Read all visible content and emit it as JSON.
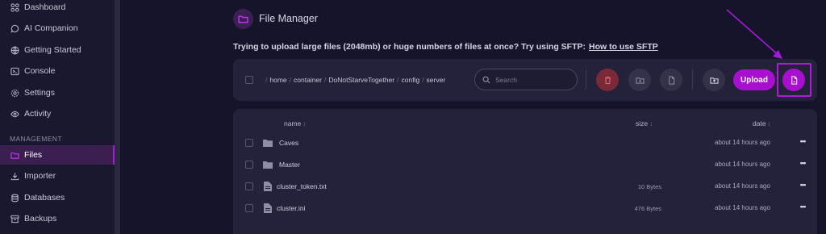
{
  "sidebar": {
    "items": [
      {
        "label": "Dashboard",
        "icon": "dashboard-icon"
      },
      {
        "label": "AI Companion",
        "icon": "chat-icon"
      },
      {
        "label": "Getting Started",
        "icon": "globe-icon"
      },
      {
        "label": "Console",
        "icon": "terminal-icon"
      },
      {
        "label": "Settings",
        "icon": "gear-icon"
      },
      {
        "label": "Activity",
        "icon": "eye-icon"
      }
    ],
    "section_label": "MANAGEMENT",
    "management_items": [
      {
        "label": "Files",
        "icon": "folder-icon",
        "active": true
      },
      {
        "label": "Importer",
        "icon": "download-icon"
      },
      {
        "label": "Databases",
        "icon": "database-icon"
      },
      {
        "label": "Backups",
        "icon": "archive-icon"
      }
    ]
  },
  "header": {
    "title": "File Manager",
    "icon": "folder-icon"
  },
  "notice": {
    "text": "Trying to upload large files (2048mb) or huge numbers of files at once? Try using SFTP:",
    "link": "How to use SFTP"
  },
  "toolbar": {
    "breadcrumb": [
      "home",
      "container",
      "DoNotStarveTogether",
      "config",
      "server"
    ],
    "search_placeholder": "Search",
    "upload_label": "Upload",
    "buttons": [
      "trash-icon",
      "folder-plus-icon",
      "file-icon",
      "folder-upload-icon",
      "file-new-icon"
    ]
  },
  "table": {
    "columns": {
      "name": "name",
      "size": "size",
      "date": "date"
    },
    "sort_arrow": "↓",
    "rows": [
      {
        "type": "folder",
        "name": "Caves",
        "size": "",
        "date": "about 14 hours ago"
      },
      {
        "type": "folder",
        "name": "Master",
        "size": "",
        "date": "about 14 hours ago"
      },
      {
        "type": "file",
        "name": "cluster_token.txt",
        "size": "10 Bytes",
        "date": "about 14 hours ago"
      },
      {
        "type": "file",
        "name": "cluster.ini",
        "size": "476 Bytes",
        "date": "about 14 hours ago"
      }
    ],
    "row_menu": "•••"
  },
  "colors": {
    "accent": "#a80fcf",
    "background": "#16142a",
    "card": "#24223a",
    "danger": "#7a2a36"
  }
}
